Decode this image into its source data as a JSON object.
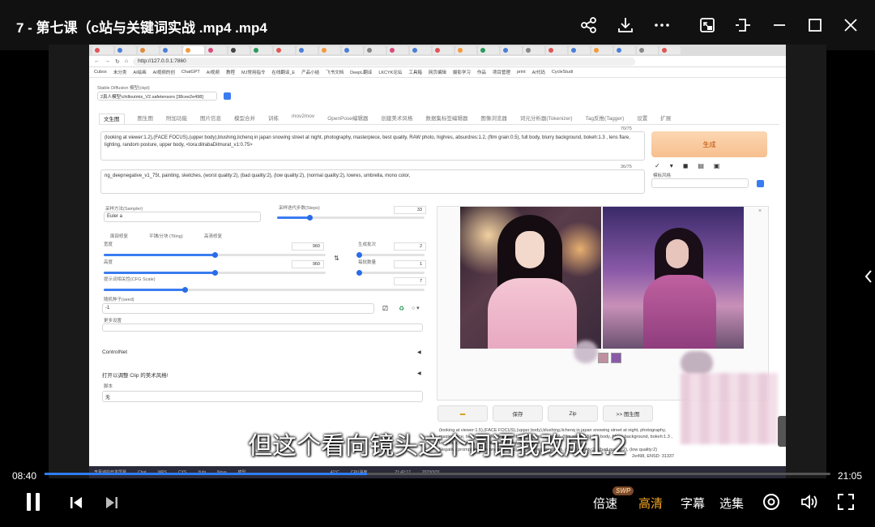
{
  "player": {
    "title": "7 - 第七课（c站与关键词实战 .mp4 .mp4",
    "subtitle": "但这个看向镜头这个词语我改成1.2",
    "time_current": "08:40",
    "time_total": "21:05",
    "progress": 0.41,
    "speed_label": "倍速",
    "speed_badge": "SWP",
    "quality_label": "高清",
    "caption_label": "字幕",
    "episodes_label": "选集"
  },
  "browser": {
    "url": "http://127.0.0.1:7860",
    "bookmarks": [
      "Cubox",
      "未分类",
      "AI绘画",
      "AI视频的创",
      "ChatGPT",
      "AI视频",
      "教程",
      "MJ常用指令",
      "在线翻译_E",
      "产品小结",
      "飞书文档",
      "DeepL翻译",
      "LKCYK论坛",
      "工具箱",
      "网页编辑",
      "摄影学习",
      "作品",
      "项目管理",
      "print",
      "AI代码",
      "CycleStudi"
    ]
  },
  "webui": {
    "checkpoint_label": "Stable Diffusion 模型(ckpt)",
    "checkpoint_value": "2真人模型\\chilloutmix_V2.safetensors [38cee2e498]",
    "tabs": [
      "文生图",
      "图生图",
      "附加功能",
      "图片信息",
      "模型合并",
      "训练",
      "mov2mov",
      "OpenPose编辑器",
      "创建美术风格",
      "数据集标签编辑器",
      "图像浏览器",
      "词元分析器(Tokenizer)",
      "Tag反推(Tagger)",
      "设置",
      "扩展"
    ],
    "positive_prompt": "(looking at viewer:1.2),(FACE FOCUS),(upper body),blushing,lichenq in japan snowing street at night, photography, masterpiece, best quality, RAW photo, highres, absurdres:1.2, (film grain:0.5), full body, blurry background, bokeh:1.3 , lens flare, lighting, random posture, upper body, <lora:dilrabaDilmurat_v1:0.75>",
    "positive_count": "70/75",
    "negative_prompt": "ng_deepnegative_v1_75t, painting, sketches, (worst quality:2), (bad quality:2), (low quality:2), (normal quality:2), lowres, umbrella, mono color,",
    "negative_count": "36/75",
    "generate_label": "生成",
    "style_label": "模板风格",
    "sampler_label": "采样方法(Sampler)",
    "sampler_value": "Euler a",
    "steps_label": "采样迭代步数(Steps)",
    "steps_value": "33",
    "restore_faces": "面部修复",
    "tiling": "平铺/分块 (Tiling)",
    "hires_fix": "高清修复",
    "width_label": "宽度",
    "width_value": "960",
    "height_label": "高度",
    "height_value": "960",
    "batch_count_label": "生成批次",
    "batch_count_value": "2",
    "batch_size_label": "每批数量",
    "batch_size_value": "1",
    "cfg_label": "提示词相关性(CFG Scale)",
    "cfg_value": "7",
    "seed_label": "随机种子(seed)",
    "seed_value": "-1",
    "extra_label": "更多设置",
    "controlnet_label": "ControlNet",
    "clip_label": "打开以调整 Clip 的美术风格!",
    "script_label": "脚本",
    "script_value": "无",
    "out_buttons": [
      "保存",
      "Zip",
      ">> 图生图"
    ],
    "out_info": "(looking at viewer:1.5),(FACE FOCUS),(upper body),blushing,lichenq in japan snowing street at night, photography, masterpiece, best quality, RAW photo, highres, absurdres:1.2, (film grain:0.5), full body, blurry background, bokeh:1.3 , lens flare, lighting, <lora:dilrabaDilmurat_v1:0.75>",
    "out_info2": "Negative prompt: ng_deepnegative_v1_75t, painting, sketches, (worst quality:2), (bad quality:2), (low quality:2)",
    "out_info3": "2e498, ENSD: 31337"
  },
  "taskbar": {
    "items": [
      "李圣城的开发屏幕",
      "Chat",
      "WPS",
      "CYS",
      "Yubi",
      "Nova",
      "模型"
    ],
    "temp": "41°C",
    "cpu": "CPU温度",
    "clock": "21:42:17",
    "date": "2023/3/31"
  },
  "colors": {
    "accent": "#2f7df6",
    "highlight": "#f5a623",
    "generate": "#f7bf8e"
  }
}
